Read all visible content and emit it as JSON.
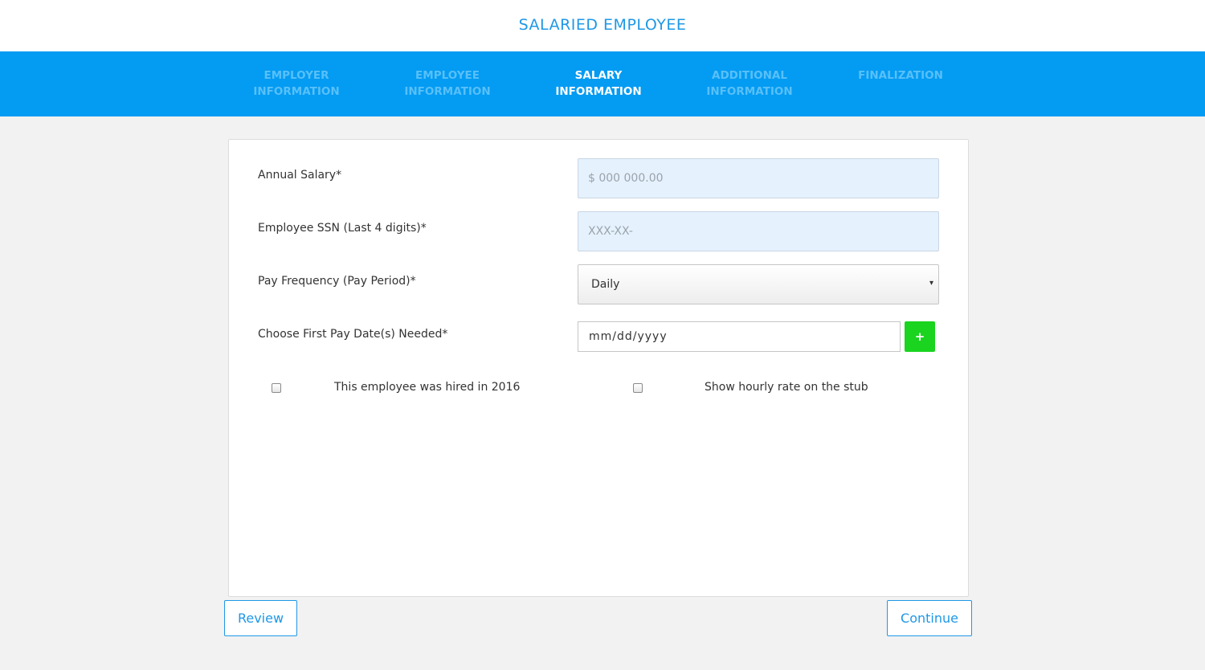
{
  "header": {
    "title": "SALARIED EMPLOYEE"
  },
  "steps": [
    {
      "line1": "EMPLOYER",
      "line2": "INFORMATION",
      "active": false
    },
    {
      "line1": "EMPLOYEE",
      "line2": "INFORMATION",
      "active": false
    },
    {
      "line1": "SALARY",
      "line2": "INFORMATION",
      "active": true
    },
    {
      "line1": "ADDITIONAL",
      "line2": "INFORMATION",
      "active": false
    },
    {
      "line1": "FINALIZATION",
      "line2": "",
      "active": false
    }
  ],
  "form": {
    "annual_salary": {
      "label": "Annual Salary*",
      "placeholder": "$ 000 000.00",
      "value": ""
    },
    "ssn": {
      "label": "Employee SSN (Last 4 digits)*",
      "placeholder": "XXX-XX-",
      "value": ""
    },
    "pay_frequency": {
      "label": "Pay Frequency (Pay Period)*",
      "selected": "Daily",
      "arrow": "▾"
    },
    "pay_date": {
      "label": "Choose First Pay Date(s) Needed*",
      "placeholder": "mm/dd/yyyy",
      "add_label": "+"
    },
    "hired_checkbox": {
      "label": "This employee was hired in 2016",
      "checked": false
    },
    "hourly_checkbox": {
      "label": "Show hourly rate on the stub",
      "checked": false
    }
  },
  "footer": {
    "review_label": "Review",
    "continue_label": "Continue"
  },
  "colors": {
    "accent": "#049bf2",
    "brand_text": "#1e98e6",
    "add_button": "#1ad41f",
    "input_fill": "#e5f1fd"
  }
}
